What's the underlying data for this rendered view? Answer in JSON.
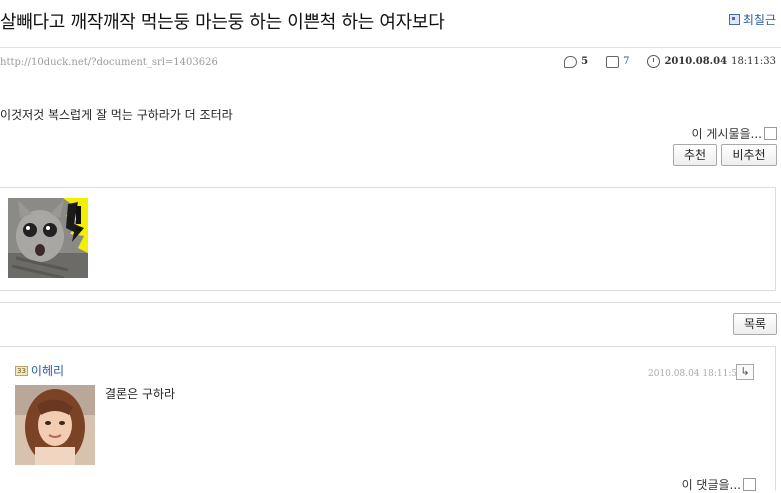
{
  "document": {
    "title": "살빼다고 깨작깨작 먹는둥 마는둥 하는 이쁜척 하는 여자보다",
    "author": "최칠근",
    "url": "http://10duck.net/?document_srl=1403626",
    "comment_count": "5",
    "read_count": "7",
    "date": "2010.08.04",
    "time": "18:11:33",
    "body": "이것저것 복스럽게 잘 먹는 구하라가 더 조터라",
    "this_post_label": "이 게시물을..."
  },
  "buttons": {
    "recommend": "추천",
    "not_recommend": "비추천",
    "list": "목록"
  },
  "comment": {
    "author": "이헤리",
    "level_badge": "33",
    "date": "2010.08.04",
    "time": "18:11:54",
    "text": "결론은 구하라",
    "this_comment_label": "이 댓글을..."
  },
  "colors": {
    "link_blue": "#2d5a9a",
    "border": "#dcdcdc"
  }
}
